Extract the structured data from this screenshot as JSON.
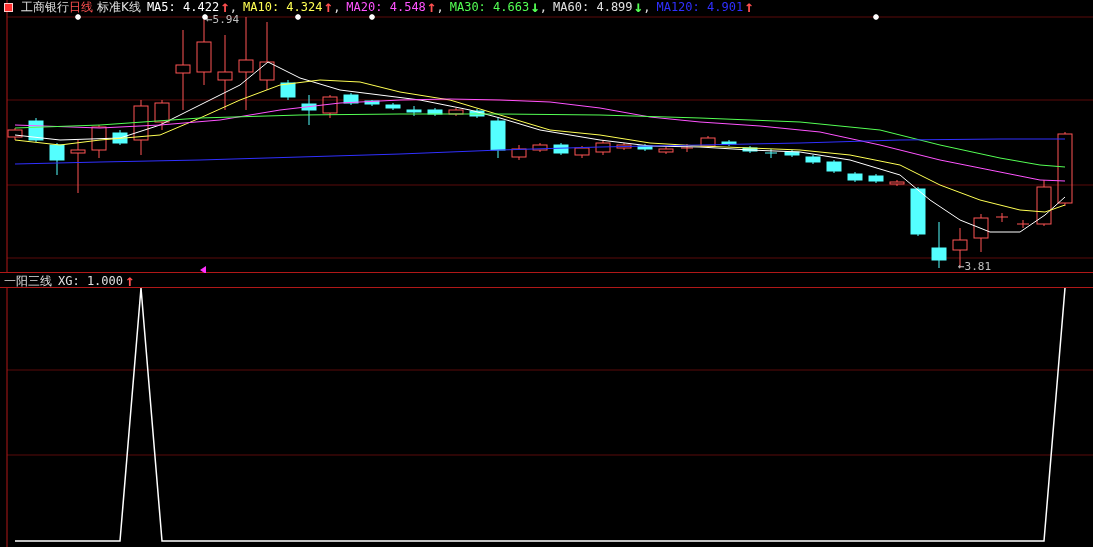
{
  "main_chart": {
    "stock_name": "工商银行",
    "period": "日线",
    "chart_type": "标准K线",
    "moving_averages": [
      {
        "label": "MA5:",
        "value": "4.422",
        "arrow": {
          "symbol": "↑",
          "color": "#ff5050"
        },
        "separator": ",",
        "color": "#ffffff"
      },
      {
        "label": "MA10:",
        "value": "4.324",
        "arrow": {
          "symbol": "↑",
          "color": "#ff5050"
        },
        "separator": ",",
        "color": "#ffff54"
      },
      {
        "label": "MA20:",
        "value": "4.548",
        "arrow": {
          "symbol": "↑",
          "color": "#ff5050"
        },
        "separator": ",",
        "color": "#ff54ff"
      },
      {
        "label": "MA30:",
        "value": "4.663",
        "arrow": {
          "symbol": "↓",
          "color": "#54ff54"
        },
        "separator": ",",
        "color": "#54ff54"
      },
      {
        "label": "MA60:",
        "value": "4.899",
        "arrow": {
          "symbol": "↓",
          "color": "#54ff54"
        },
        "separator": ",",
        "color": "#e0e0e0"
      },
      {
        "label": "MA120:",
        "value": "4.901",
        "arrow": {
          "symbol": "↑",
          "color": "#ff5050"
        },
        "color": "#3030ff"
      }
    ],
    "high_label": "←5.94",
    "low_label": "←3.81"
  },
  "indicator": {
    "name": "一阳三线",
    "reading": "XG: 1.000",
    "arrow": {
      "symbol": "↑",
      "color": "#ff5050"
    }
  }
}
